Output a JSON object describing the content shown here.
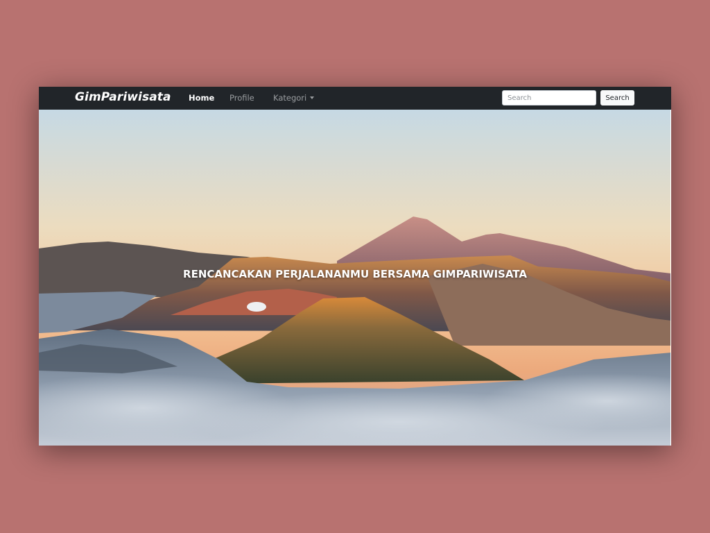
{
  "navbar": {
    "brand": "GimPariwisata",
    "items": [
      {
        "label": "Home",
        "active": true
      },
      {
        "label": "Profile",
        "active": false
      },
      {
        "label": "Kategori",
        "active": false,
        "dropdown": true
      }
    ],
    "search": {
      "placeholder": "Search",
      "value": "",
      "button_label": "Search"
    }
  },
  "hero": {
    "title": "RENCANCAKAN PERJALANANMU BERSAMA GIMPARIWISATA",
    "image": "volcanic-landscape-at-sunrise"
  },
  "colors": {
    "page_background": "#b87270",
    "navbar_background": "#212529",
    "nav_active": "#ffffff",
    "nav_inactive": "#9a9da0"
  }
}
